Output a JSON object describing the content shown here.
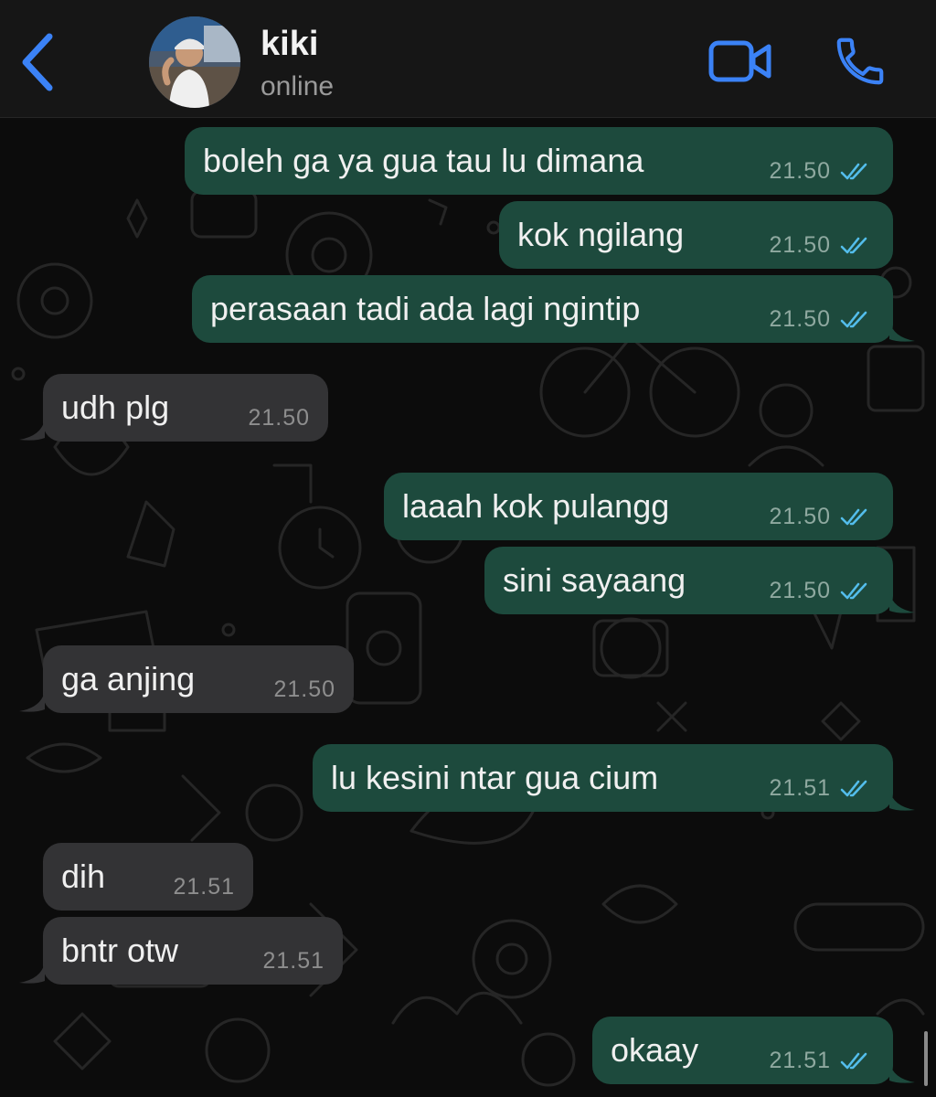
{
  "header": {
    "contact_name": "kiki",
    "status": "online"
  },
  "colors": {
    "accent": "#3b82f6",
    "outgoing_bubble": "#1d4a3d",
    "incoming_bubble": "#333335",
    "read_ticks": "#53bdeb",
    "header_bg": "#161616",
    "chat_bg": "#0c0c0c"
  },
  "icons": {
    "back": "chevron-left-icon",
    "video": "video-camera-icon",
    "call": "phone-icon",
    "read_receipt": "double-check-icon"
  },
  "messages": [
    {
      "direction": "out",
      "text": "boleh ga ya gua tau lu dimana",
      "time": "21.50",
      "read": true
    },
    {
      "direction": "out",
      "text": "kok ngilang",
      "time": "21.50",
      "read": true
    },
    {
      "direction": "out",
      "text": "perasaan tadi ada lagi ngintip",
      "time": "21.50",
      "read": true
    },
    {
      "direction": "in",
      "text": "udh plg",
      "time": "21.50"
    },
    {
      "direction": "out",
      "text": "laaah kok pulangg",
      "time": "21.50",
      "read": true
    },
    {
      "direction": "out",
      "text": "sini sayaang",
      "time": "21.50",
      "read": true
    },
    {
      "direction": "in",
      "text": "ga anjing",
      "time": "21.50"
    },
    {
      "direction": "out",
      "text": "lu kesini ntar gua cium",
      "time": "21.51",
      "read": true
    },
    {
      "direction": "in",
      "text": "dih",
      "time": "21.51"
    },
    {
      "direction": "in",
      "text": "bntr otw",
      "time": "21.51"
    },
    {
      "direction": "out",
      "text": "okaay",
      "time": "21.51",
      "read": true
    }
  ]
}
